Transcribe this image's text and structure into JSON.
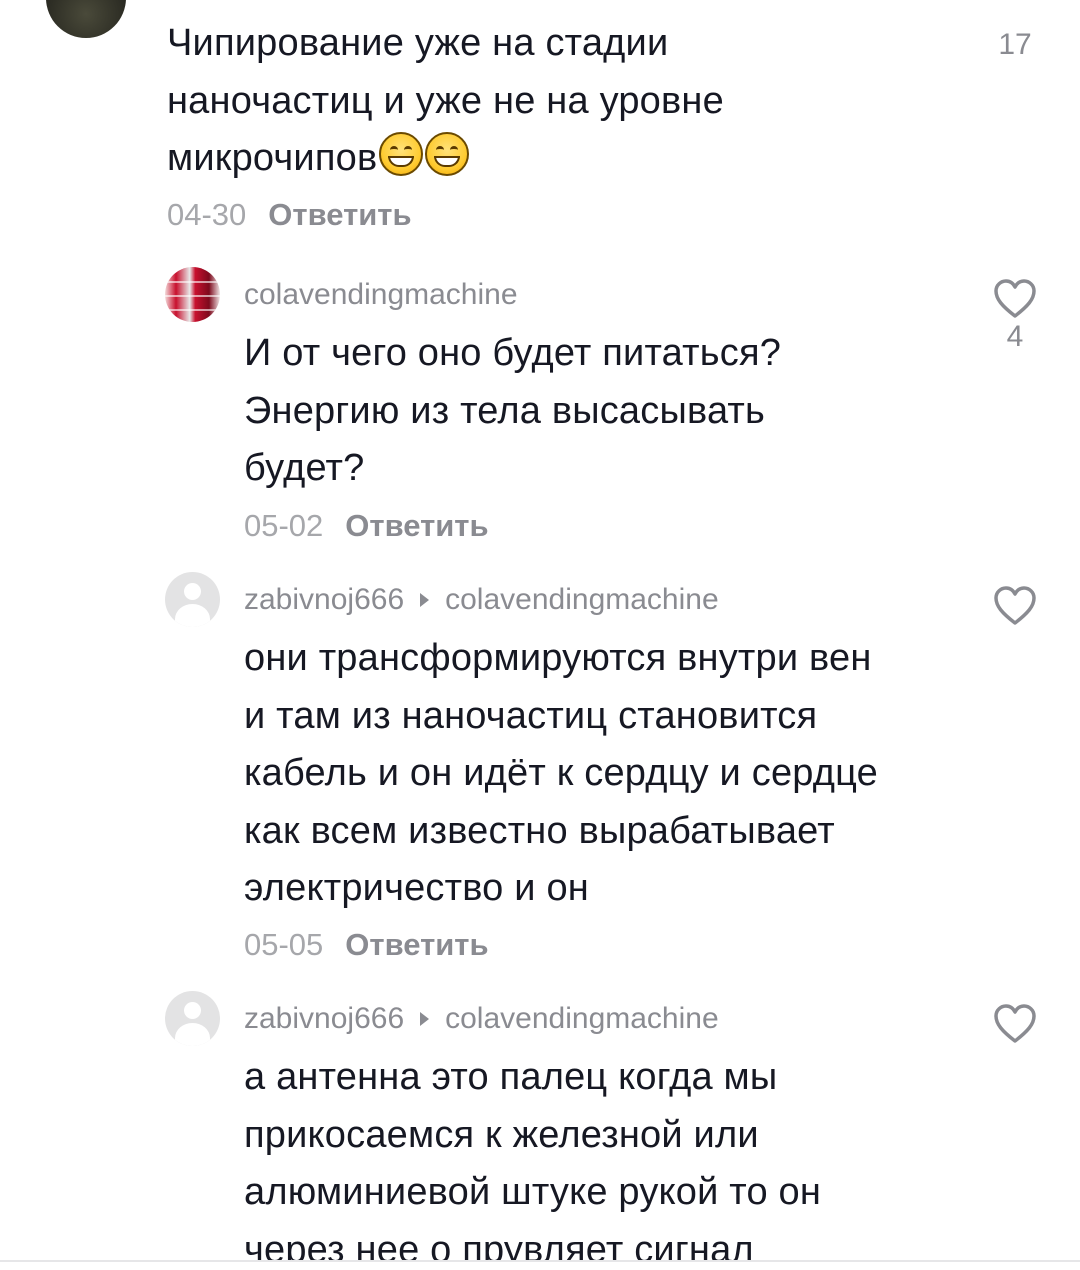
{
  "comments": {
    "top": {
      "lines": [
        "Чипирование уже на стадии",
        "наночастиц и уже не на уровне",
        "микрочипов"
      ],
      "emoji": [
        "grinning-face-emoji",
        "grinning-face-emoji"
      ],
      "like_count": "17",
      "date": "04-30",
      "reply_label": "Ответить"
    },
    "reply1": {
      "username": "colavendingmachine",
      "lines": [
        "И от чего оно будет питаться?",
        "Энергию из тела высасывать",
        "будет?"
      ],
      "like_count": "4",
      "date": "05-02",
      "reply_label": "Ответить"
    },
    "reply2": {
      "username": "zabivnoj666",
      "reply_to": "colavendingmachine",
      "lines": [
        "они трансформируются внутри вен",
        "и там из наночастиц становится",
        "кабель и он идёт к сердцу и сердце",
        "как всем известно вырабатывает",
        "электричество и он"
      ],
      "date": "05-05",
      "reply_label": "Ответить"
    },
    "reply3": {
      "username": "zabivnoj666",
      "reply_to": "colavendingmachine",
      "lines": [
        "а антенна это палец когда мы",
        "прикосаемся к железной или",
        "алюминиевой штуке рукой то он",
        "через нее о прувляет сигнал"
      ]
    }
  },
  "colors": {
    "text": "#161823",
    "secondary": "#8a8b91",
    "date": "#a6a7ab"
  },
  "icons": {
    "like": "heart-outline-icon",
    "reply_arrow": "caret-right-icon"
  }
}
